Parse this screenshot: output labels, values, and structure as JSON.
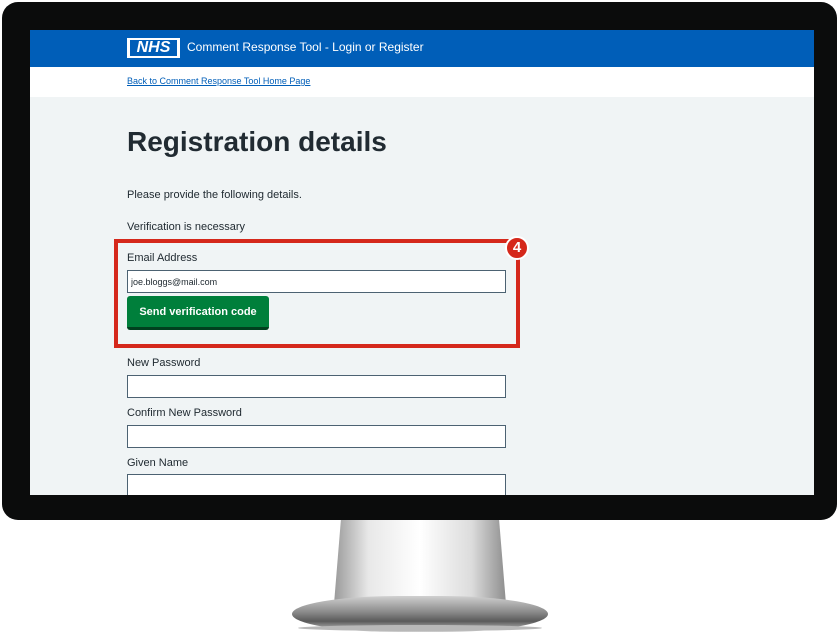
{
  "header": {
    "logo_text": "NHS",
    "title": "Comment Response Tool - Login or Register"
  },
  "nav": {
    "back_link": "Back to Comment Response Tool Home Page"
  },
  "main": {
    "title": "Registration details",
    "intro": "Please provide the following details.",
    "verification_note": "Verification is necessary"
  },
  "form": {
    "email": {
      "label": "Email Address",
      "value": "joe.bloggs@mail.com"
    },
    "send_code_button": "Send verification code",
    "new_password": {
      "label": "New Password",
      "value": ""
    },
    "confirm_password": {
      "label": "Confirm New Password",
      "value": ""
    },
    "given_name": {
      "label": "Given Name",
      "value": ""
    }
  },
  "callout": {
    "step_number": "4",
    "color": "#d5281b"
  },
  "colors": {
    "nhs_blue": "#005eb8",
    "button_green": "#007f3b",
    "page_background": "#f0f4f5"
  }
}
